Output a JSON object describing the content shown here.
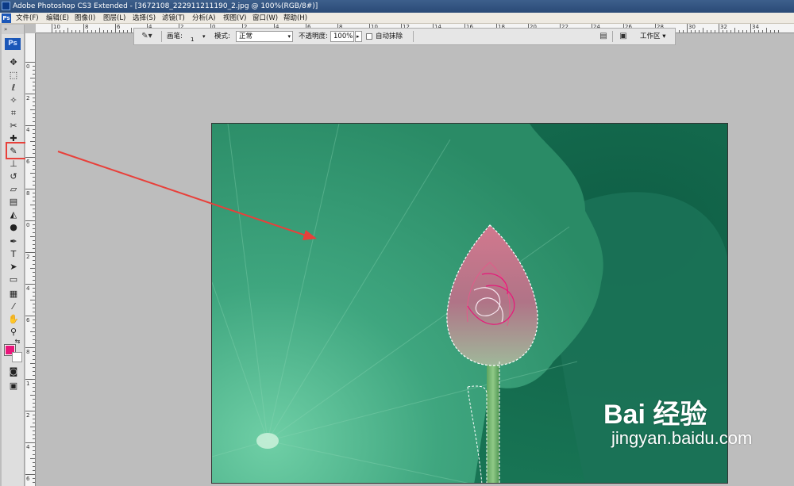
{
  "window": {
    "title": "Adobe Photoshop CS3 Extended - [3672108_222911211190_2.jpg @ 100%(RGB/8#)]"
  },
  "menu": {
    "app_icon": "Ps",
    "items": [
      "文件(F)",
      "编辑(E)",
      "图像(I)",
      "图层(L)",
      "选择(S)",
      "滤镜(T)",
      "分析(A)",
      "视图(V)",
      "窗口(W)",
      "帮助(H)"
    ]
  },
  "rulers": {
    "top_numbers": [
      "10",
      "8",
      "6",
      "4",
      "2",
      "0",
      "2",
      "4",
      "6",
      "8",
      "10",
      "12",
      "14",
      "16",
      "18",
      "20",
      "22",
      "24",
      "26",
      "28",
      "30",
      "32",
      "34"
    ],
    "left_numbers": [
      "0",
      "2",
      "4",
      "6",
      "8",
      "0",
      "2",
      "4",
      "6",
      "8",
      "1",
      "2",
      "4",
      "6",
      "8",
      "0",
      "2"
    ]
  },
  "toolbox": {
    "grip_label": "»",
    "logo": "Ps",
    "tools": [
      {
        "name": "move-tool-icon",
        "glyph": "✥"
      },
      {
        "name": "marquee-tool-icon",
        "glyph": "⬚"
      },
      {
        "name": "lasso-tool-icon",
        "glyph": "ℓ"
      },
      {
        "name": "magic-wand-tool-icon",
        "glyph": "✧"
      },
      {
        "name": "crop-tool-icon",
        "glyph": "⌗"
      },
      {
        "name": "slice-tool-icon",
        "glyph": "✂"
      },
      {
        "name": "healing-brush-tool-icon",
        "glyph": "✚"
      },
      {
        "name": "brush-tool-icon",
        "glyph": "✎"
      },
      {
        "name": "clone-stamp-tool-icon",
        "glyph": "⊥"
      },
      {
        "name": "history-brush-tool-icon",
        "glyph": "↺"
      },
      {
        "name": "eraser-tool-icon",
        "glyph": "▱"
      },
      {
        "name": "gradient-tool-icon",
        "glyph": "▤"
      },
      {
        "name": "blur-tool-icon",
        "glyph": "◭"
      },
      {
        "name": "dodge-tool-icon",
        "glyph": "●"
      },
      {
        "name": "pen-tool-icon",
        "glyph": "✒"
      },
      {
        "name": "type-tool-icon",
        "glyph": "T"
      },
      {
        "name": "path-selection-tool-icon",
        "glyph": "➤"
      },
      {
        "name": "shape-tool-icon",
        "glyph": "▭"
      },
      {
        "name": "notes-tool-icon",
        "glyph": "▦"
      },
      {
        "name": "eyedropper-tool-icon",
        "glyph": "⁄"
      },
      {
        "name": "hand-tool-icon",
        "glyph": "✋"
      },
      {
        "name": "zoom-tool-icon",
        "glyph": "⚲"
      },
      {
        "name": "reset-colors-icon",
        "glyph": "⇆"
      },
      {
        "name": "quick-mask-icon",
        "glyph": "◙"
      },
      {
        "name": "screen-mode-icon",
        "glyph": "▣"
      }
    ],
    "foreground_color": "#e8177a",
    "background_color": "#ffffff",
    "highlight_color": "#e8403a"
  },
  "options": {
    "brush_tool_icon": "brush-icon",
    "brush_label": "画笔:",
    "brush_size": "1",
    "mode_label": "模式:",
    "mode_value": "正常",
    "opacity_label": "不透明度:",
    "opacity_value": "100%",
    "auto_erase_label": "自动抹除",
    "workspace_label": "工作区 ▾"
  },
  "watermark": {
    "brand": "Bai 经验",
    "url": "jingyan.baidu.com"
  },
  "colors": {
    "arrow": "#e8403a",
    "canvas_green": "#1e7f5d",
    "leaf_green": "#3ea07c"
  }
}
